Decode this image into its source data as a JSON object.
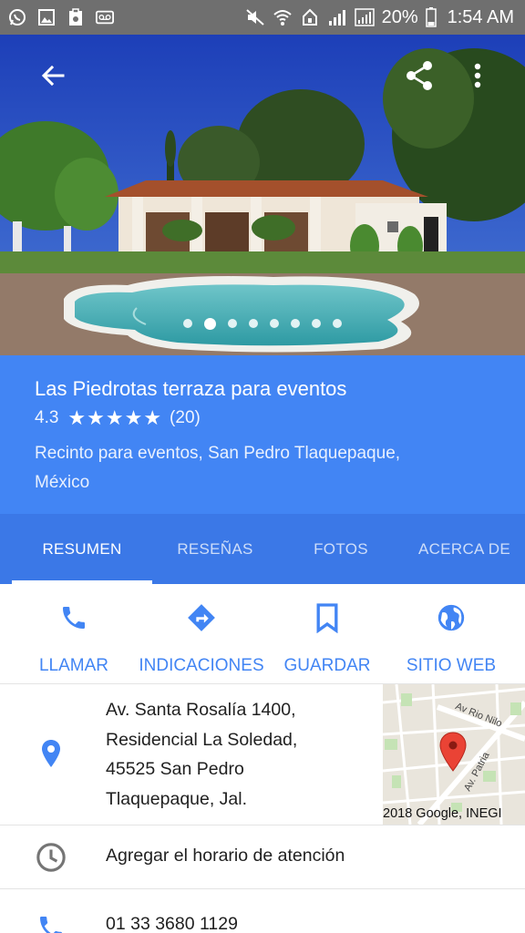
{
  "status_bar": {
    "left_icons": [
      "whatsapp-icon",
      "gallery-icon",
      "clipboard-icon",
      "voicemail-icon"
    ],
    "right_icons": [
      "mute-icon",
      "wifi-icon",
      "data-icon",
      "signal-icon",
      "signal-icon",
      "battery-icon"
    ],
    "battery": "20%",
    "time": "1:54 AM"
  },
  "hero": {
    "photo_count": 8,
    "active_photo": 2
  },
  "place": {
    "name": "Las Piedrotas terraza para eventos",
    "rating": "4.3",
    "stars": "★★★★★",
    "review_count": "(20)",
    "category_line1": "Recinto para eventos, San Pedro Tlaquepaque,",
    "category_line2": "México"
  },
  "tabs": [
    {
      "label": "RESUMEN",
      "active": true
    },
    {
      "label": "RESEÑAS",
      "active": false
    },
    {
      "label": "FOTOS",
      "active": false
    },
    {
      "label": "ACERCA DE",
      "active": false
    }
  ],
  "actions": {
    "call": "LLAMAR",
    "directions": "INDICACIONES",
    "save": "GUARDAR",
    "website": "SITIO WEB"
  },
  "address": {
    "line1": "Av. Santa Rosalía 1400,",
    "line2": "Residencial La Soledad,",
    "line3": "45525 San Pedro",
    "line4": "Tlaquepaque, Jal."
  },
  "map": {
    "street1": "Av Rio Nilo",
    "street2": "Av. Patria",
    "credit": "2018 Google, INEGI"
  },
  "hours": {
    "label": "Agregar el horario de atención"
  },
  "phone": {
    "number": "01 33 3680 1129"
  },
  "colors": {
    "primary": "#4285f4",
    "tabs_bg": "#3b78e7",
    "status_bar": "#6f6f6f",
    "icon_gray": "#757575",
    "map_pin": "#ea4335"
  }
}
